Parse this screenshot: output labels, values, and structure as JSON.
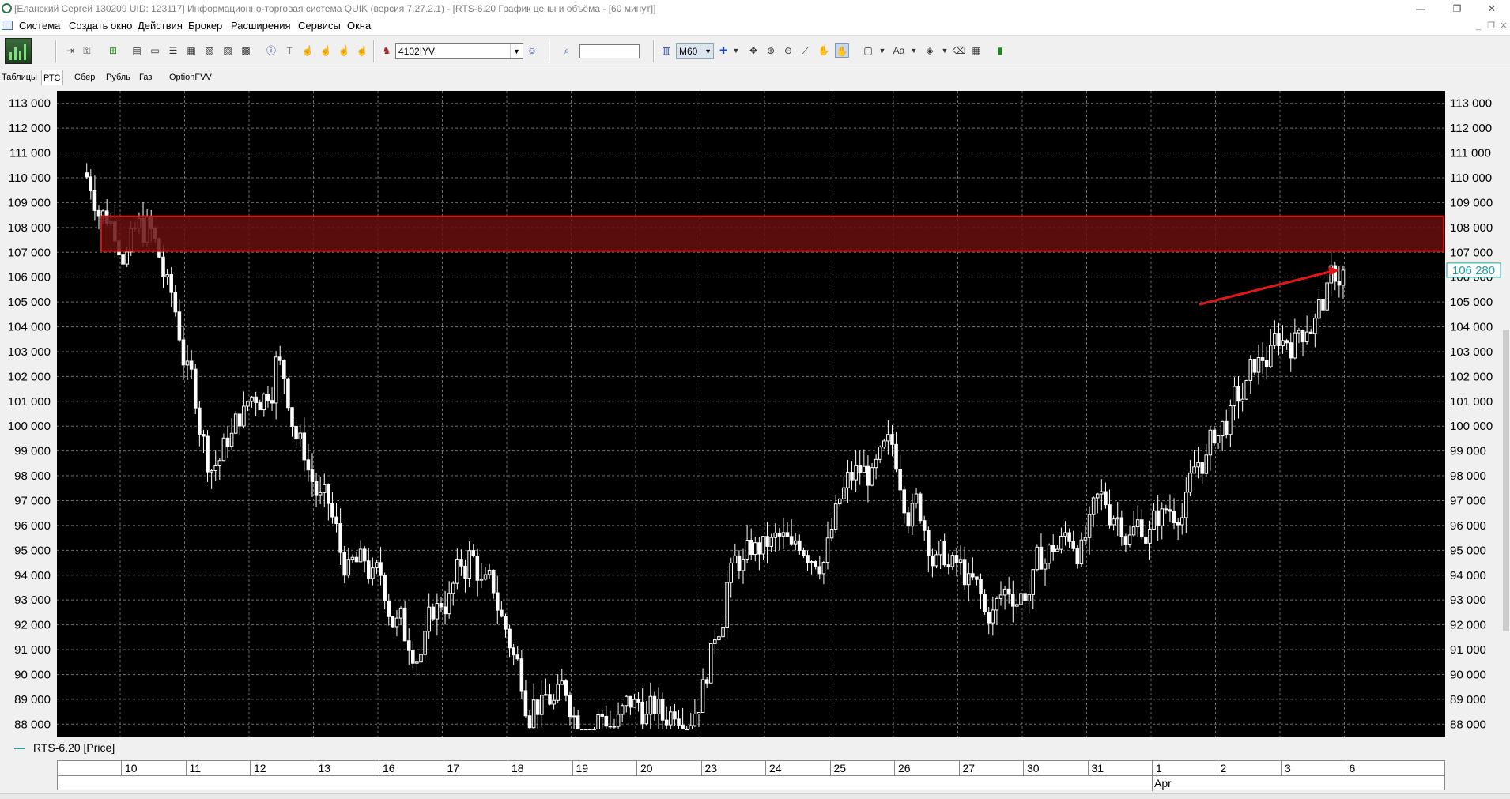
{
  "window": {
    "title": "[Еланский Сергей 130209 UID: 123117] Информационно-торговая система QUIK (версия 7.27.2.1) - [RTS-6.20 График цены и объёма - [60 минут]]",
    "minimize": "—",
    "restore": "❐",
    "close": "✕"
  },
  "menu": {
    "items": [
      "Система",
      "Создать окно",
      "Действия",
      "Брокер",
      "Расширения",
      "Сервисы",
      "Окна"
    ]
  },
  "toolbar": {
    "instrument": "4102IYV",
    "interval": "M60",
    "search_value": ""
  },
  "tabs": [
    {
      "label": "Таблицы",
      "active": false
    },
    {
      "label": "РТС",
      "active": true
    },
    {
      "label": "Сбер",
      "active": false
    },
    {
      "label": "Рубль",
      "active": false
    },
    {
      "label": "Газ",
      "active": false
    },
    {
      "label": "OptionFVV",
      "active": false
    }
  ],
  "chart_data": {
    "type": "candlestick",
    "series_name": "RTS-6.20 [Price]",
    "ylim": [
      87500,
      113500
    ],
    "y_ticks": [
      "113 000",
      "112 000",
      "111 000",
      "110 000",
      "109 000",
      "108 000",
      "107 000",
      "106 000",
      "105 000",
      "104 000",
      "103 000",
      "102 000",
      "101 000",
      "100 000",
      "99 000",
      "98 000",
      "97 000",
      "96 000",
      "95 000",
      "94 000",
      "93 000",
      "92 000",
      "91 000",
      "90 000",
      "89 000",
      "88 000"
    ],
    "y_tick_values": [
      113000,
      112000,
      111000,
      110000,
      109000,
      108000,
      107000,
      106000,
      105000,
      104000,
      103000,
      102000,
      101000,
      100000,
      99000,
      98000,
      97000,
      96000,
      95000,
      94000,
      93000,
      92000,
      91000,
      90000,
      89000,
      88000
    ],
    "x_ticks": [
      "10",
      "11",
      "12",
      "13",
      "16",
      "17",
      "18",
      "19",
      "20",
      "23",
      "24",
      "25",
      "26",
      "27",
      "30",
      "31",
      "1",
      "2",
      "3",
      "6"
    ],
    "month_label": "Apr",
    "last_price_label": "106 280",
    "last_price": 106280,
    "resistance_zone": [
      107050,
      108450
    ],
    "daily_closes": [
      110200,
      107800,
      98300,
      102400,
      95000,
      91800,
      94600,
      88700,
      88100,
      88300,
      93600,
      94800,
      98000,
      96800,
      92400,
      94800,
      96500,
      96800,
      101200,
      104200,
      106280
    ],
    "grid": true,
    "colors": {
      "background": "#000000",
      "candle": "#ffffff",
      "grid": "#6e6e6e",
      "zone_fill": "#6a0f0f",
      "zone_border": "#d21414",
      "arrow": "#e01818",
      "axis_text": "#000000",
      "price_label": "#1aa3a3"
    }
  }
}
